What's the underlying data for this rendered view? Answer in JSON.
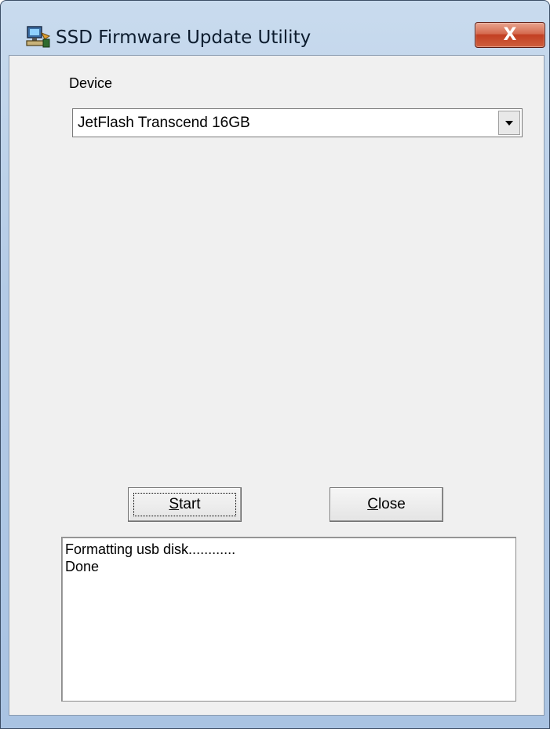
{
  "window": {
    "title": "SSD Firmware Update Utility",
    "close_label": "X",
    "icon": "computer-icon"
  },
  "device": {
    "label": "Device",
    "selected_value": "JetFlash Transcend 16GB",
    "arrow_icon": "chevron-down-icon"
  },
  "buttons": {
    "start_accel": "S",
    "start_rest": "tart",
    "close_accel": "C",
    "close_rest": "lose"
  },
  "log": {
    "lines": [
      "Formatting usb disk............",
      "Done"
    ]
  },
  "colors": {
    "frame": "#b4cbe6",
    "close_button": "#c23f22",
    "client_bg": "#f0f0f0"
  }
}
